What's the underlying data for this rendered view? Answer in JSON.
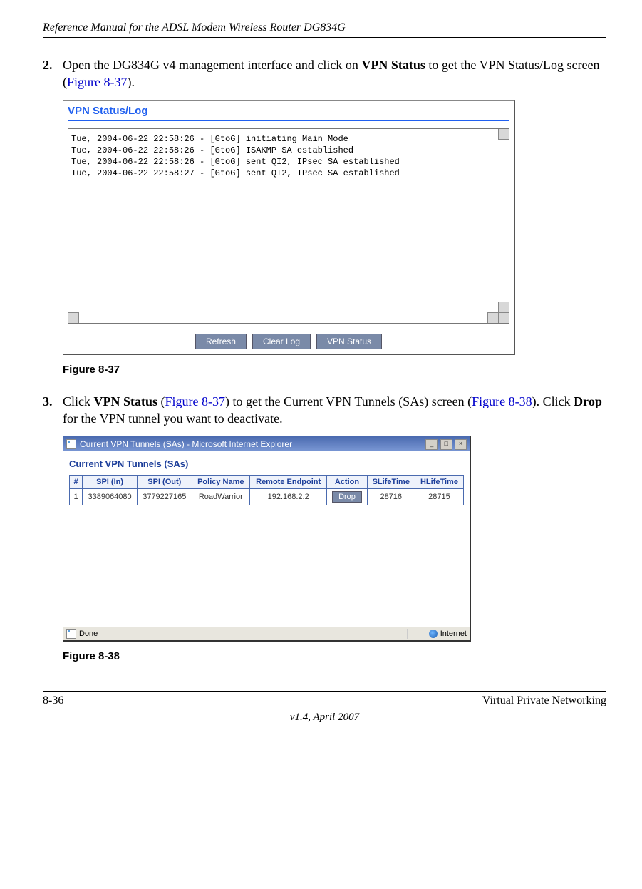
{
  "header": {
    "title": "Reference Manual for the ADSL Modem Wireless Router DG834G"
  },
  "step2": {
    "num": "2.",
    "pre": "Open the DG834G v4 management interface and click on ",
    "bold": "VPN Status",
    "mid": " to get the VPN Status/Log screen (",
    "fig": "Figure 8-37",
    "post": ")."
  },
  "vpnlog": {
    "title": "VPN Status/Log",
    "lines": [
      "Tue, 2004-06-22 22:58:26 - [GtoG] initiating Main Mode",
      "Tue, 2004-06-22 22:58:26 - [GtoG] ISAKMP SA established",
      "Tue, 2004-06-22 22:58:26 - [GtoG] sent QI2, IPsec SA established",
      "Tue, 2004-06-22 22:58:27 - [GtoG] sent QI2, IPsec SA established"
    ],
    "buttons": {
      "refresh": "Refresh",
      "clear": "Clear Log",
      "status": "VPN Status"
    }
  },
  "fig37": "Figure 8-37",
  "step3": {
    "num": "3.",
    "t1": "Click ",
    "b1": "VPN Status",
    "t2": " (",
    "fig1": "Figure 8-37",
    "t3": ") to get the Current VPN Tunnels (SAs) screen (",
    "fig2": "Figure 8-38",
    "t4": "). Click ",
    "b2": "Drop",
    "t5": " for the VPN tunnel you want to deactivate."
  },
  "iewin": {
    "title": "Current VPN Tunnels (SAs) - Microsoft Internet Explorer",
    "heading": "Current VPN Tunnels (SAs)",
    "headers": [
      "#",
      "SPI (In)",
      "SPI (Out)",
      "Policy Name",
      "Remote Endpoint",
      "Action",
      "SLifeTime",
      "HLifeTime"
    ],
    "row": {
      "num": "1",
      "spi_in": "3389064080",
      "spi_out": "3779227165",
      "policy": "RoadWarrior",
      "remote": "192.168.2.2",
      "action": "Drop",
      "slife": "28716",
      "hlife": "28715"
    },
    "status": {
      "done": "Done",
      "zone": "Internet"
    }
  },
  "fig38": "Figure 8-38",
  "footer": {
    "left": "8-36",
    "right": "Virtual Private Networking",
    "center": "v1.4, April 2007"
  }
}
